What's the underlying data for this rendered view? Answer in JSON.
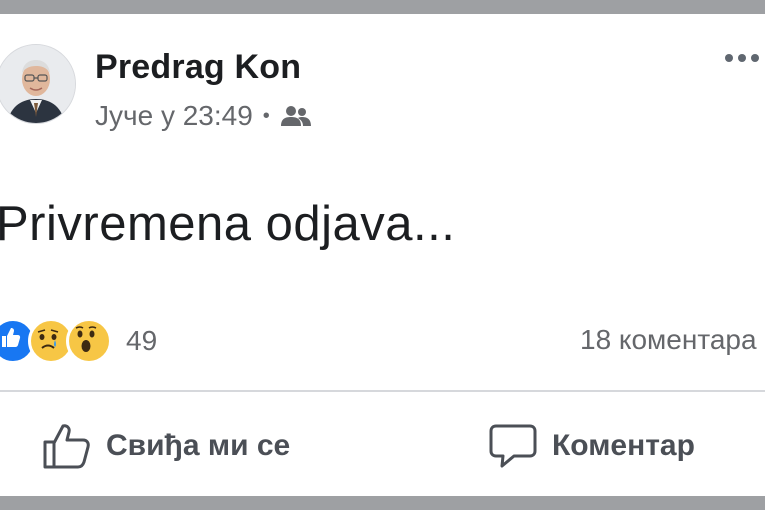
{
  "post": {
    "author": "Predrag Kon",
    "timestamp": "Јуче у 23:49",
    "separator": "•",
    "audience_icon": "friends-icon",
    "text": "Privremena odjava...",
    "reactions": {
      "types": [
        "like",
        "sad",
        "wow"
      ],
      "count": "49"
    },
    "comment_count": "18 коментара"
  },
  "actions": {
    "like_label": "Свиђа ми се",
    "comment_label": "Коментар"
  },
  "colors": {
    "like_blue": "#1877f2",
    "emoji_yellow": "#f7c645",
    "secondary_text": "#65676b"
  }
}
